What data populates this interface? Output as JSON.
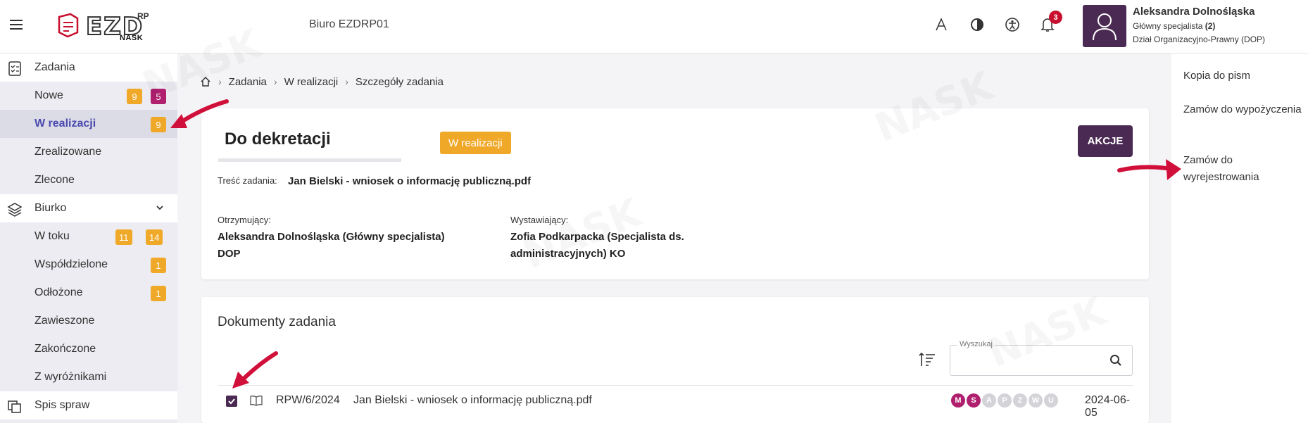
{
  "header": {
    "office": "Biuro EZDRP01",
    "logo": {
      "name": "EZD",
      "suffix": "RP",
      "org": "NASK"
    },
    "notifications_count": "3",
    "user": {
      "name": "Aleksandra Dolnośląska",
      "role_prefix": "Główny specjalista",
      "role_count": "(2)",
      "department": "Dział Organizacyjno-Prawny (DOP)"
    }
  },
  "sidebar": {
    "zadania": {
      "label": "Zadania",
      "items": [
        {
          "label": "Nowe",
          "counts": [
            "9",
            "5"
          ]
        },
        {
          "label": "W realizacji",
          "counts": [
            "9"
          ]
        },
        {
          "label": "Zrealizowane",
          "counts": []
        },
        {
          "label": "Zlecone",
          "counts": []
        }
      ]
    },
    "biurko": {
      "label": "Biurko",
      "items": [
        {
          "label": "W toku",
          "counts": [
            "11",
            "14"
          ]
        },
        {
          "label": "Współdzielone",
          "counts": [
            "1"
          ]
        },
        {
          "label": "Odłożone",
          "counts": [
            "1"
          ]
        },
        {
          "label": "Zawieszone",
          "counts": []
        },
        {
          "label": "Zakończone",
          "counts": []
        },
        {
          "label": "Z wyróżnikami",
          "counts": []
        }
      ]
    },
    "spis_spraw": {
      "label": "Spis spraw"
    }
  },
  "breadcrumb": [
    "Zadania",
    "W realizacji",
    "Szczegóły zadania"
  ],
  "task": {
    "title": "Do dekretacji",
    "status": "W realizacji",
    "actions_label": "AKCJE",
    "content_label": "Treść zadania:",
    "content_value": "Jan Bielski - wniosek o informację publiczną.pdf",
    "receiver_label": "Otrzymujący:",
    "receiver_line1": "Aleksandra Dolnośląska (Główny specjalista)",
    "receiver_line2": "DOP",
    "issuer_label": "Wystawiający:",
    "issuer_line1": "Zofia Podkarpacka (Specjalista ds.",
    "issuer_line2": "administracyjnych) KO"
  },
  "documents": {
    "title": "Dokumenty zadania",
    "search_legend": "Wyszukaj",
    "search_value": "",
    "rows": [
      {
        "signature": "RPW/6/2024",
        "filename": "Jan Bielski - wniosek o informację publiczną.pdf",
        "date": "2024-06-05",
        "flags": [
          {
            "letter": "M",
            "active": true
          },
          {
            "letter": "S",
            "active": true
          },
          {
            "letter": "A",
            "active": false
          },
          {
            "letter": "P",
            "active": false
          },
          {
            "letter": "Z",
            "active": false
          },
          {
            "letter": "W",
            "active": false
          },
          {
            "letter": "U",
            "active": false
          }
        ]
      }
    ]
  },
  "right_panel": {
    "links": [
      "Kopia do pism",
      "Zamów do wypożyczenia",
      "Zamów do wyrejestrowania"
    ]
  },
  "colors": {
    "brand_purple": "#4a2a52",
    "orange": "#f0a828",
    "magenta": "#b0206e",
    "notification_red": "#c8102e",
    "arrow_red": "#d0103a"
  }
}
